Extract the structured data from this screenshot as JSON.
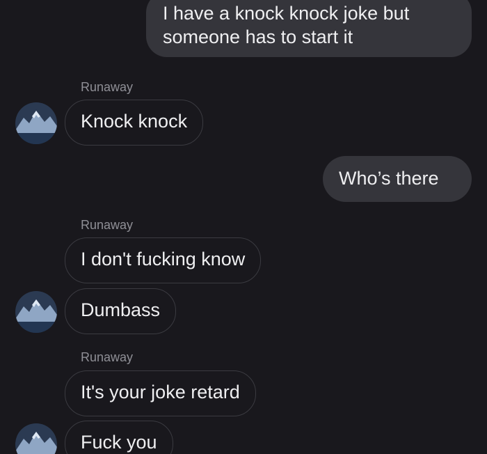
{
  "conversation": {
    "messages": [
      {
        "direction": "outgoing",
        "text": "I have a knock knock joke but someone has to start it"
      },
      {
        "direction": "incoming",
        "sender": "Runaway",
        "text": "Knock knock",
        "avatar": "mountain-avatar-icon"
      },
      {
        "direction": "outgoing",
        "text": "Who’s there"
      },
      {
        "direction": "incoming",
        "sender": "Runaway",
        "text": "I don't fucking know"
      },
      {
        "direction": "incoming",
        "text": "Dumbass",
        "avatar": "mountain-avatar-icon"
      },
      {
        "direction": "incoming",
        "sender": "Runaway",
        "text": "It's your joke retard"
      },
      {
        "direction": "incoming",
        "text": "Fuck you",
        "avatar": "mountain-avatar-icon"
      }
    ]
  },
  "colors": {
    "background": "#19181d",
    "outgoing_bubble": "#35353b",
    "incoming_border": "#3b3b41",
    "sender_label": "#8f8f96",
    "text": "#efeff1"
  }
}
